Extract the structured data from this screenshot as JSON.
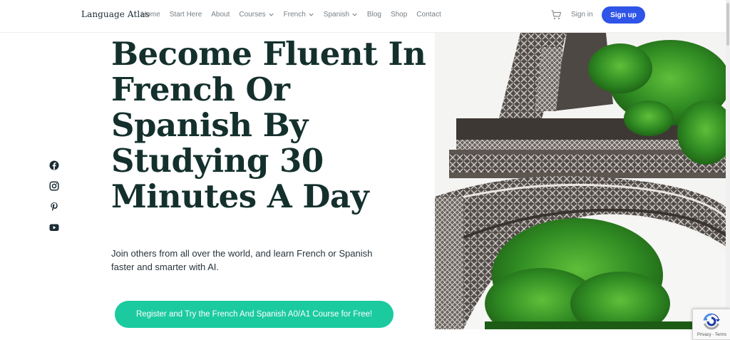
{
  "header": {
    "brand": "Language Atlas",
    "nav": [
      {
        "label": "Home",
        "dropdown": false
      },
      {
        "label": "Start Here",
        "dropdown": false
      },
      {
        "label": "About",
        "dropdown": false
      },
      {
        "label": "Courses",
        "dropdown": true
      },
      {
        "label": "French",
        "dropdown": true
      },
      {
        "label": "Spanish",
        "dropdown": true
      },
      {
        "label": "Blog",
        "dropdown": false
      },
      {
        "label": "Shop",
        "dropdown": false
      },
      {
        "label": "Contact",
        "dropdown": false
      }
    ],
    "cart_icon": "cart-icon",
    "signin_label": "Sign in",
    "signup_label": "Sign up"
  },
  "social": [
    {
      "icon": "facebook-icon"
    },
    {
      "icon": "instagram-icon"
    },
    {
      "icon": "pinterest-icon"
    },
    {
      "icon": "youtube-icon"
    }
  ],
  "hero": {
    "title_lines": [
      "Become Fluent In",
      "French Or",
      "Spanish By",
      "Studying 30",
      "Minutes A Day"
    ],
    "subtitle": "Join others from all over the world, and learn French or Spanish faster and smarter with AI.",
    "cta_label": "Register and Try the French And Spanish A0/A1 Course for Free!"
  },
  "recaptcha": {
    "text": "Privacy - Terms"
  },
  "colors": {
    "title": "#14302d",
    "signup_bg": "#2f54e8",
    "cta_bg": "#1ccaa0",
    "nav_text": "#777f86"
  }
}
